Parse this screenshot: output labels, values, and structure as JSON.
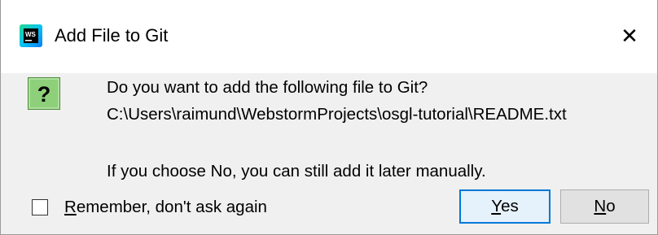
{
  "window": {
    "title": "Add File to Git",
    "app_icon": "webstorm-icon",
    "close_glyph": "✕"
  },
  "message": {
    "icon": "question-icon",
    "icon_glyph": "?",
    "line1": "Do you want to add the following file to Git?",
    "path": "C:\\Users\\raimund\\WebstormProjects\\osgl-tutorial\\README.txt",
    "line3": "If you choose No, you can still add it later manually."
  },
  "remember": {
    "mnemonic": "R",
    "rest": "emember, don't ask again",
    "checked": false
  },
  "buttons": {
    "yes": {
      "mnemonic": "Y",
      "rest": "es"
    },
    "no": {
      "mnemonic": "N",
      "rest": "o"
    }
  },
  "colors": {
    "title_bg": "#ffffff",
    "body_bg": "#f0f0f0",
    "accent_border": "#0078d7",
    "question_icon_bg": "#8ed07a"
  }
}
